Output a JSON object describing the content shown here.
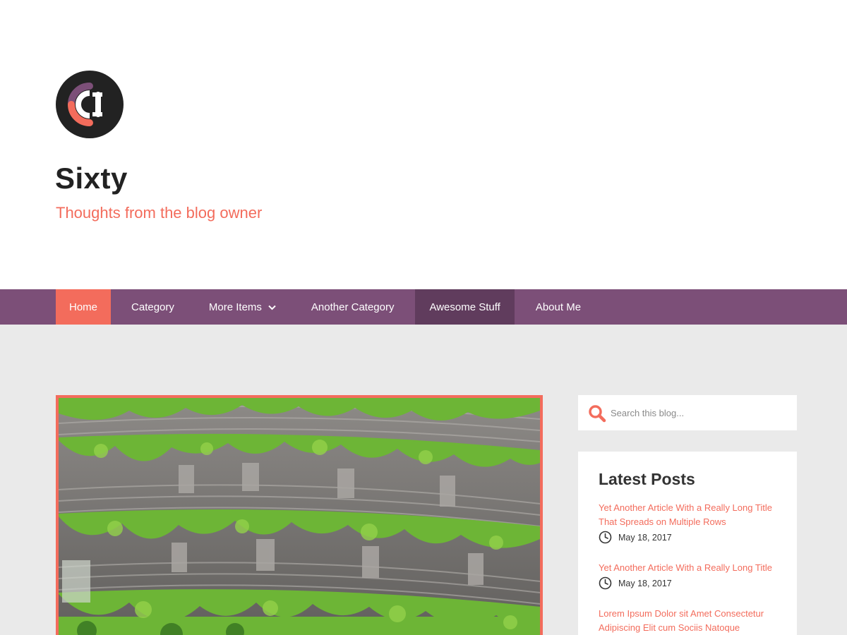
{
  "header": {
    "logo": "logo-mark",
    "title": "Sixty",
    "tagline": "Thoughts from the blog owner"
  },
  "nav": {
    "items": [
      {
        "label": "Home",
        "state": "active"
      },
      {
        "label": "Category"
      },
      {
        "label": "More Items",
        "has_dropdown": true
      },
      {
        "label": "Another Category"
      },
      {
        "label": "Awesome Stuff",
        "state": "hover"
      },
      {
        "label": "About Me"
      }
    ]
  },
  "featured": {
    "image": "building-with-hanging-plants"
  },
  "search": {
    "placeholder": "Search this blog..."
  },
  "latest_posts": {
    "title": "Latest Posts",
    "posts": [
      {
        "title": "Yet Another Article With a Really Long Title That Spreads on Multiple Rows",
        "date": "May 18, 2017"
      },
      {
        "title": "Yet Another Article With a Really Long Title",
        "date": "May 18, 2017"
      },
      {
        "title": "Lorem Ipsum Dolor sit Amet Consectetur Adipiscing Elit cum Sociis Natoque",
        "date": ""
      }
    ]
  },
  "icons": {
    "search": "search-icon",
    "clock": "clock-icon",
    "dropdown": "chevron-down-icon"
  },
  "colors": {
    "accent": "#f36c5c",
    "nav_bg": "#7c4f78",
    "nav_hover": "#603c5d",
    "dark": "#222222",
    "main_bg": "#eaeaea"
  }
}
